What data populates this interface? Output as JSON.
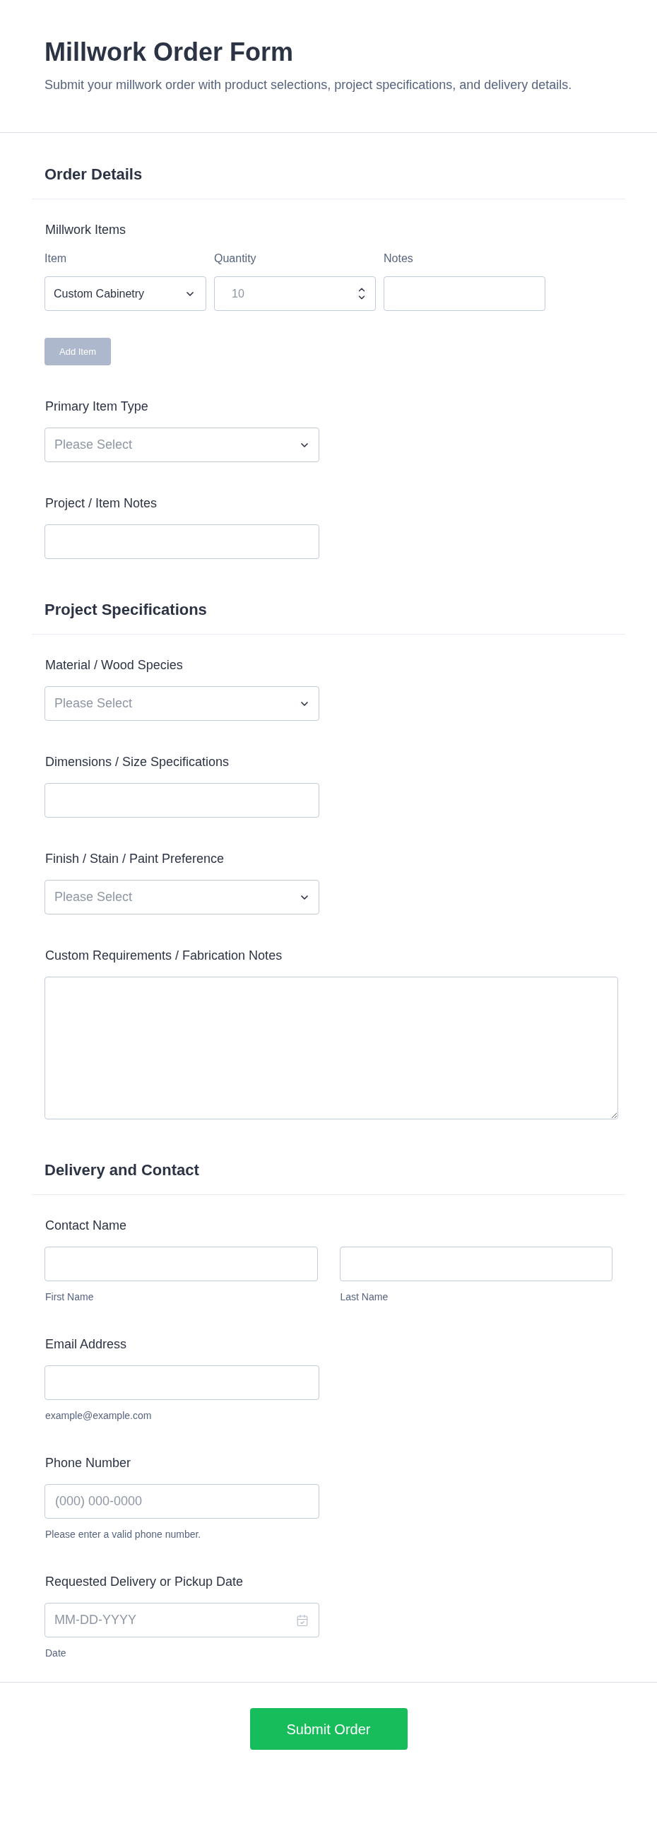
{
  "header": {
    "title": "Millwork Order Form",
    "description": "Submit your millwork order with product selections, project specifications, and delivery details."
  },
  "sections": [
    {
      "title": "Order Details",
      "fields": [
        {
          "kind": "item_table",
          "label": "Millwork Items",
          "columns": [
            "Item",
            "Quantity",
            "Notes"
          ],
          "rows": [
            {
              "item": "Custom Cabinetry",
              "quantity": "10"
            }
          ],
          "add_button": {
            "label": "Add Item",
            "disabled": true
          }
        },
        {
          "kind": "select",
          "label": "Primary Item Type",
          "placeholder": "Please Select"
        },
        {
          "kind": "text",
          "label": "Project / Item Notes"
        }
      ]
    },
    {
      "title": "Project Specifications",
      "fields": [
        {
          "kind": "select",
          "label": "Material / Wood Species",
          "placeholder": "Please Select"
        },
        {
          "kind": "text",
          "label": "Dimensions / Size Specifications"
        },
        {
          "kind": "select",
          "label": "Finish / Stain / Paint Preference",
          "placeholder": "Please Select"
        },
        {
          "kind": "textarea",
          "label": "Custom Requirements / Fabrication Notes"
        }
      ]
    },
    {
      "title": "Delivery and Contact",
      "fields": [
        {
          "kind": "name",
          "label": "Contact Name",
          "parts": [
            {
              "hint": "First Name"
            },
            {
              "hint": "Last Name"
            }
          ]
        },
        {
          "kind": "text",
          "label": "Email Address",
          "hint": "example@example.com"
        },
        {
          "kind": "text",
          "label": "Phone Number",
          "placeholder": "(000) 000-0000",
          "hint": "Please enter a valid phone number."
        },
        {
          "kind": "date",
          "label": "Requested Delivery or Pickup Date",
          "placeholder": "MM-DD-YYYY",
          "hint": "Date"
        }
      ]
    }
  ],
  "submit_button": {
    "label": "Submit Order"
  }
}
